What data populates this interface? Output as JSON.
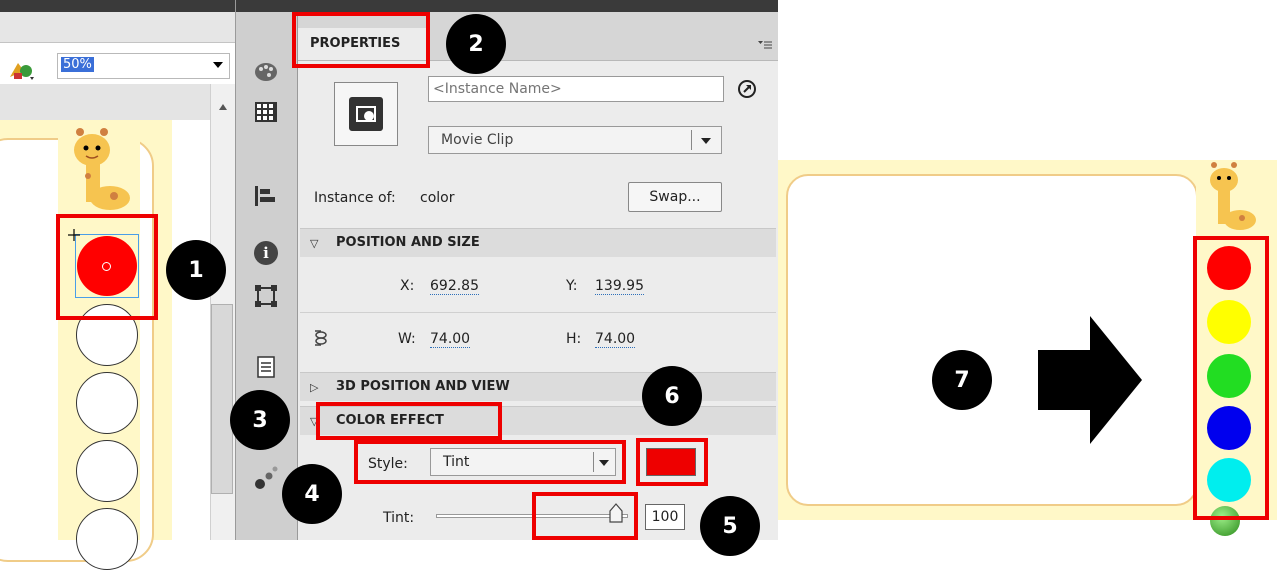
{
  "stage_panel": {
    "zoom_value": "50%"
  },
  "properties_panel": {
    "tab_label": "PROPERTIES",
    "instance_name_placeholder": "<Instance Name>",
    "symbol_type": "Movie Clip",
    "instance_of_label": "Instance of:",
    "instance_of_value": "color",
    "swap_button": "Swap...",
    "position_section": "POSITION AND SIZE",
    "x_label": "X:",
    "x_value": "692.85",
    "y_label": "Y:",
    "y_value": "139.95",
    "w_label": "W:",
    "w_value": "74.00",
    "h_label": "H:",
    "h_value": "74.00",
    "view_section": "3D POSITION AND VIEW",
    "color_section": "COLOR EFFECT",
    "style_label": "Style:",
    "style_value": "Tint",
    "tint_label": "Tint:",
    "tint_value": "100",
    "tint_color": "#ee0000"
  },
  "callouts": [
    "1",
    "2",
    "3",
    "4",
    "5",
    "6",
    "7"
  ],
  "result_swatches": [
    "#ff0000",
    "#ffff00",
    "#22dd22",
    "#0000ee",
    "#00eeee"
  ],
  "colors": {
    "highlight_red": "#ee0000",
    "frame_yellow": "#fff8c8"
  }
}
